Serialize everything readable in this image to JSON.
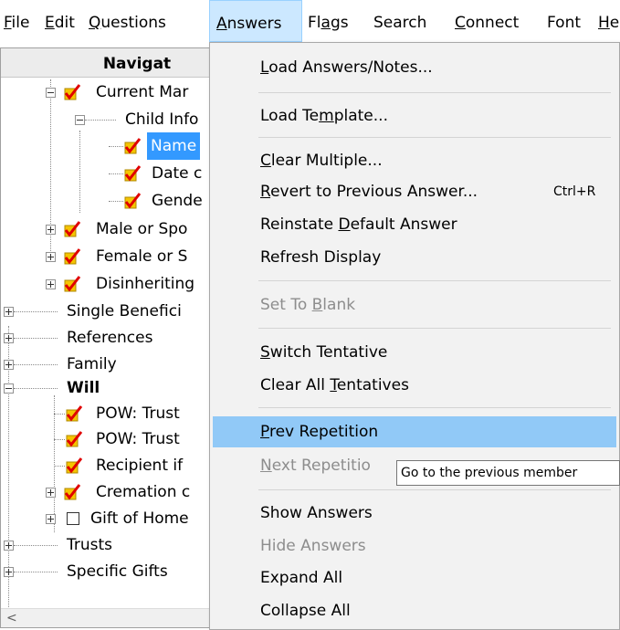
{
  "menubar": {
    "items": [
      {
        "label": "File",
        "mnemonic": "F",
        "rest": "ile"
      },
      {
        "label": "Edit",
        "mnemonic": "E",
        "rest": "dit"
      },
      {
        "label": "Questions",
        "mnemonic": "Q",
        "rest": "uestions"
      },
      {
        "label": "Answers",
        "mnemonic": "A",
        "rest": "nswers"
      },
      {
        "label": "Flags",
        "pre": "Fl",
        "mnemonic": "a",
        "rest": "gs"
      },
      {
        "label": "Search"
      },
      {
        "label": "Connect",
        "mnemonic": "C",
        "rest": "onnect"
      },
      {
        "label": "Font"
      },
      {
        "label": "He",
        "mnemonic": "H",
        "rest": "e"
      }
    ]
  },
  "tree": {
    "header": "Navigat",
    "rows": [
      {
        "label": "Current Mar",
        "checked": true
      },
      {
        "label": "Child Info"
      },
      {
        "label": "Name",
        "checked": true,
        "selected": true
      },
      {
        "label": "Date c",
        "checked": true
      },
      {
        "label": "Gende",
        "checked": true
      },
      {
        "label": "Male or Spo",
        "checked": true
      },
      {
        "label": "Female or S",
        "checked": true
      },
      {
        "label": "Disinheriting",
        "checked": true
      },
      {
        "label": "Single Benefici"
      },
      {
        "label": "References"
      },
      {
        "label": "Family"
      },
      {
        "label": "Will"
      },
      {
        "label": "POW: Trust",
        "checked": true
      },
      {
        "label": "POW: Trust",
        "checked": true
      },
      {
        "label": "Recipient if",
        "checked": true
      },
      {
        "label": "Cremation c",
        "checked": true
      },
      {
        "label": "Gift of Home",
        "checked": false
      },
      {
        "label": "Trusts"
      },
      {
        "label": "Specific Gifts"
      }
    ],
    "scroll_left_glyph": "<"
  },
  "menu": {
    "items": [
      {
        "pre": "",
        "mn": "L",
        "post": "oad Answers/Notes..."
      },
      {
        "pre": "Load Te",
        "mn": "m",
        "post": "plate..."
      },
      {
        "pre": "",
        "mn": "C",
        "post": "lear Multiple..."
      },
      {
        "pre": "",
        "mn": "R",
        "post": "evert to Previous Answer...",
        "shortcut": "Ctrl+R"
      },
      {
        "pre": "Reinstate ",
        "mn": "D",
        "post": "efault Answer"
      },
      {
        "pre": "Refresh Display",
        "mn": "",
        "post": ""
      },
      {
        "pre": "Set To ",
        "mn": "B",
        "post": "lank",
        "disabled": true
      },
      {
        "pre": "",
        "mn": "S",
        "post": "witch Tentative"
      },
      {
        "pre": "Clear All ",
        "mn": "T",
        "post": "entatives"
      },
      {
        "pre": "",
        "mn": "P",
        "post": "rev Repetition",
        "highlighted": true
      },
      {
        "pre": "",
        "mn": "N",
        "post": "ext Repetitio",
        "disabled": true
      },
      {
        "pre": "Show Answers",
        "mn": "",
        "post": ""
      },
      {
        "pre": "Hide Answers",
        "mn": "",
        "post": "",
        "disabled": true
      },
      {
        "pre": "Expand All",
        "mn": "",
        "post": ""
      },
      {
        "pre": "Collapse All",
        "mn": "",
        "post": ""
      }
    ]
  },
  "tooltip": "Go to the previous member",
  "colors": {
    "menu_bg": "#f2f2f2",
    "highlight": "#91c9f7",
    "active_menubar": "#cce8ff",
    "selection": "#3399ff",
    "checkmark": "#e00000",
    "checkbox_fill": "#f5c400"
  }
}
